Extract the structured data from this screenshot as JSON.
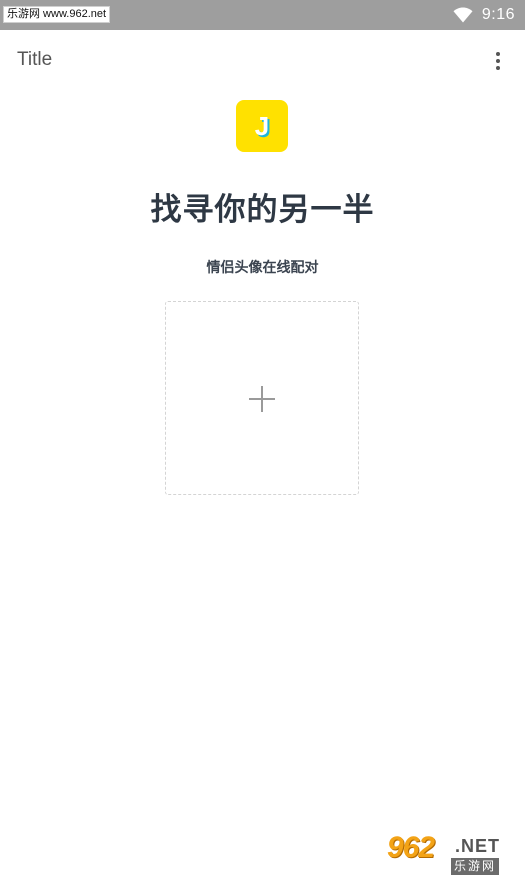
{
  "status_bar": {
    "watermark": "乐游网 www.962.net",
    "time": "9:16",
    "wifi_icon": "wifi-icon"
  },
  "app_bar": {
    "title": "Title",
    "overflow_icon": "more-vert-icon"
  },
  "logo": {
    "letter": "J",
    "bg_color": "#ffe100",
    "shadow_color": "#1fb5d9"
  },
  "main": {
    "heading": "找寻你的另一半",
    "subheading": "情侣头像在线配对",
    "upload_icon": "plus-icon"
  },
  "watermark_bottom": {
    "number": "962",
    "net": ".NET",
    "cn": "乐游网"
  }
}
